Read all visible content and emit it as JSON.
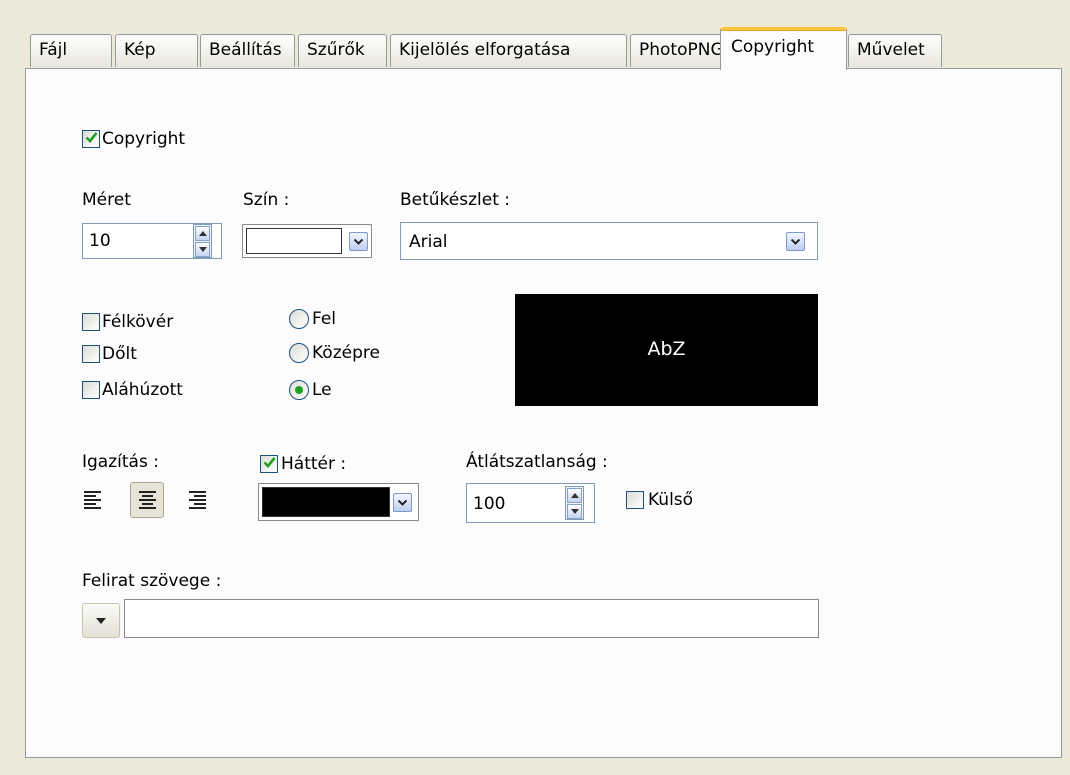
{
  "tabs": [
    "Fájl",
    "Kép",
    "Beállítás",
    "Szűrők",
    "Kijelölés elforgatása",
    "PhotoPNG",
    "Copyright",
    "Művelet"
  ],
  "active_tab": "Copyright",
  "copyright": {
    "label": "Copyright",
    "checked": true
  },
  "size": {
    "label": "Méret",
    "value": "10"
  },
  "color": {
    "label": "Szín :",
    "value_color": "#ffffff"
  },
  "font": {
    "label": "Betűkészlet :",
    "value": "Arial"
  },
  "styles": [
    {
      "label": "Félkövér",
      "checked": false
    },
    {
      "label": "Dőlt",
      "checked": false
    },
    {
      "label": "Aláhúzott",
      "checked": false
    }
  ],
  "position": [
    {
      "label": "Fel",
      "selected": false
    },
    {
      "label": "Középre",
      "selected": false
    },
    {
      "label": "Le",
      "selected": true
    }
  ],
  "preview": {
    "text": "AbZ",
    "background": "#000000",
    "color": "#ffffff"
  },
  "alignment": {
    "label": "Igazítás :",
    "options": [
      "align-left",
      "align-center",
      "align-right"
    ],
    "selected": "align-center"
  },
  "background": {
    "label": "Háttér :",
    "checked": true,
    "value_color": "#000000"
  },
  "opacity": {
    "label": "Átlátszatlanság :",
    "value": "100"
  },
  "external": {
    "label": "Külső",
    "checked": false
  },
  "caption": {
    "label": "Felirat szövege :",
    "value": ""
  },
  "colors": {
    "check": "#21a121",
    "tab_highlight": "#ffc83c",
    "border": "#7f9db9"
  }
}
